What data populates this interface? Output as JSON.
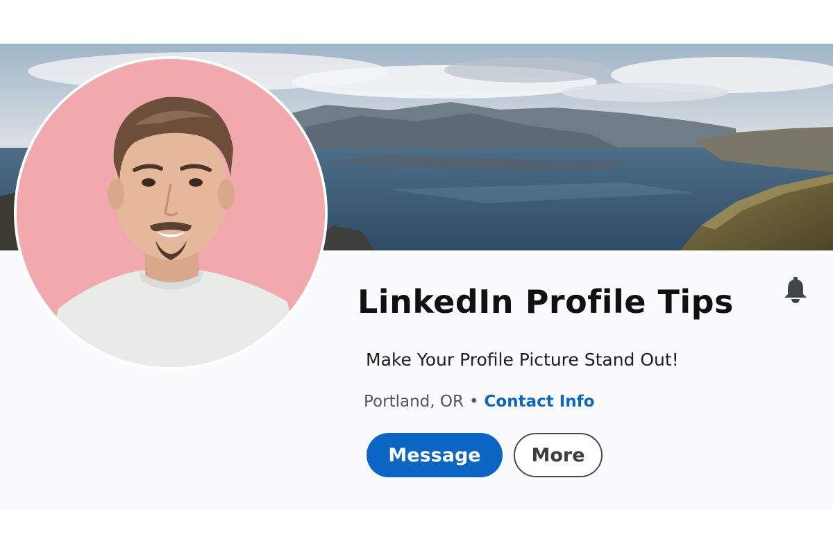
{
  "profile": {
    "name": "LinkedIn Profile Tips",
    "headline": "Make Your Profile Picture Stand Out!",
    "location": "Portland, OR",
    "separator": "•",
    "contact_info_label": "Contact Info"
  },
  "actions": {
    "message_label": "Message",
    "more_label": "More"
  },
  "icons": {
    "notification": "bell-icon"
  },
  "colors": {
    "accent": "#0a66c2",
    "avatar_background": "#f1a9ad",
    "card_background": "#fbfbfd",
    "name_text": "#111111"
  }
}
